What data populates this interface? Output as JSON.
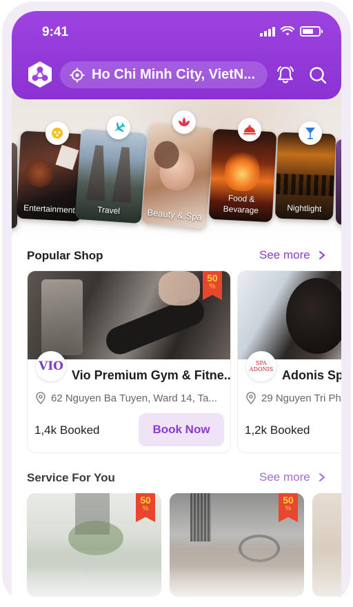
{
  "status": {
    "time": "9:41"
  },
  "header": {
    "location": "Ho Chi Minh City, VietN...",
    "icons": [
      "app-logo-icon",
      "location-target-icon",
      "bell-icon",
      "search-icon"
    ]
  },
  "categories": [
    {
      "label": "Entertainment",
      "icon": "gamepad-icon"
    },
    {
      "label": "Travel",
      "icon": "airplane-icon"
    },
    {
      "label": "Beauty & Spa",
      "icon": "lotus-icon"
    },
    {
      "label": "Food &\nBevarage",
      "icon": "food-cloche-icon"
    },
    {
      "label": "Nightlight",
      "icon": "cocktail-icon"
    }
  ],
  "popular": {
    "title": "Popular Shop",
    "see_more": "See more",
    "shops": [
      {
        "logo_text": "VIO",
        "name": "Vio Premium Gym & Fitne...",
        "address": "62 Nguyen Ba Tuyen, Ward 14, Ta...",
        "booked": "1,4k Booked",
        "button": "Book Now",
        "discount": "50",
        "discount_unit": "%"
      },
      {
        "logo_text": "SPA ADONIS",
        "name": "Adonis Spa",
        "address": "29 Nguyen Tri Ph",
        "booked": "1,2k Booked"
      }
    ]
  },
  "services": {
    "title": "Service For You",
    "see_more": "See more",
    "items": [
      {
        "discount": "50",
        "discount_unit": "%"
      },
      {
        "discount": "50",
        "discount_unit": "%"
      }
    ]
  },
  "colors": {
    "brand": "#8a32d3",
    "accent_text": "#8a3ad0",
    "discount": "#e8462e"
  }
}
